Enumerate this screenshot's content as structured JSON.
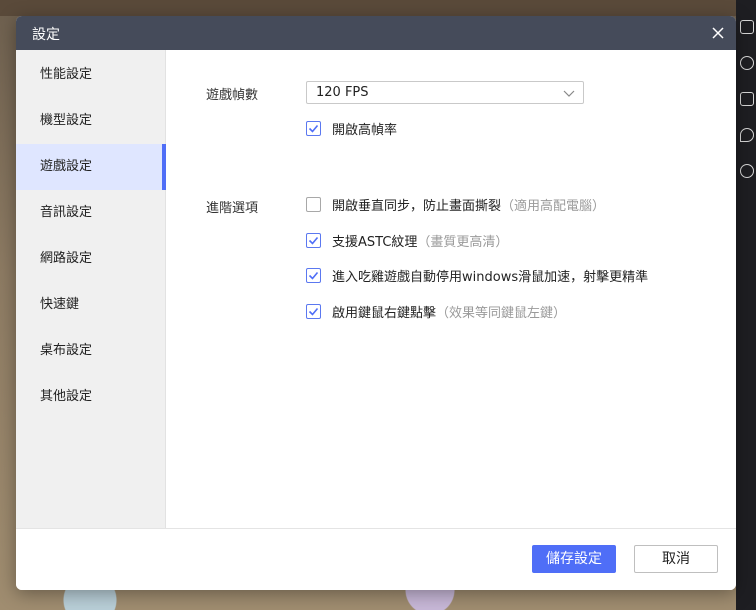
{
  "dialog": {
    "title": "設定"
  },
  "sidebar": {
    "items": [
      {
        "label": "性能設定"
      },
      {
        "label": "機型設定"
      },
      {
        "label": "遊戲設定",
        "active": true
      },
      {
        "label": "音訊設定"
      },
      {
        "label": "網路設定"
      },
      {
        "label": "快速鍵"
      },
      {
        "label": "桌布設定"
      },
      {
        "label": "其他設定"
      }
    ]
  },
  "game": {
    "fps_label": "遊戲幀數",
    "fps_value": "120 FPS",
    "high_fps": {
      "label": "開啟高幀率",
      "checked": true
    },
    "advanced_label": "進階選項",
    "options": [
      {
        "label": "開啟垂直同步，防止畫面撕裂",
        "hint": "（適用高配電腦）",
        "checked": false
      },
      {
        "label": "支援ASTC紋理",
        "hint": "（畫質更高清）",
        "checked": true
      },
      {
        "label": "進入吃雞遊戲自動停用windows滑鼠加速，射擊更精準",
        "hint": "",
        "checked": true
      },
      {
        "label": "啟用鍵鼠右鍵點擊",
        "hint": "（效果等同鍵鼠左鍵）",
        "checked": true
      }
    ]
  },
  "footer": {
    "save_label": "儲存設定",
    "cancel_label": "取消"
  },
  "colors": {
    "accent": "#4f6ef7",
    "titlebar": "#454b5a",
    "active_nav_bg": "#dfe6ff"
  }
}
